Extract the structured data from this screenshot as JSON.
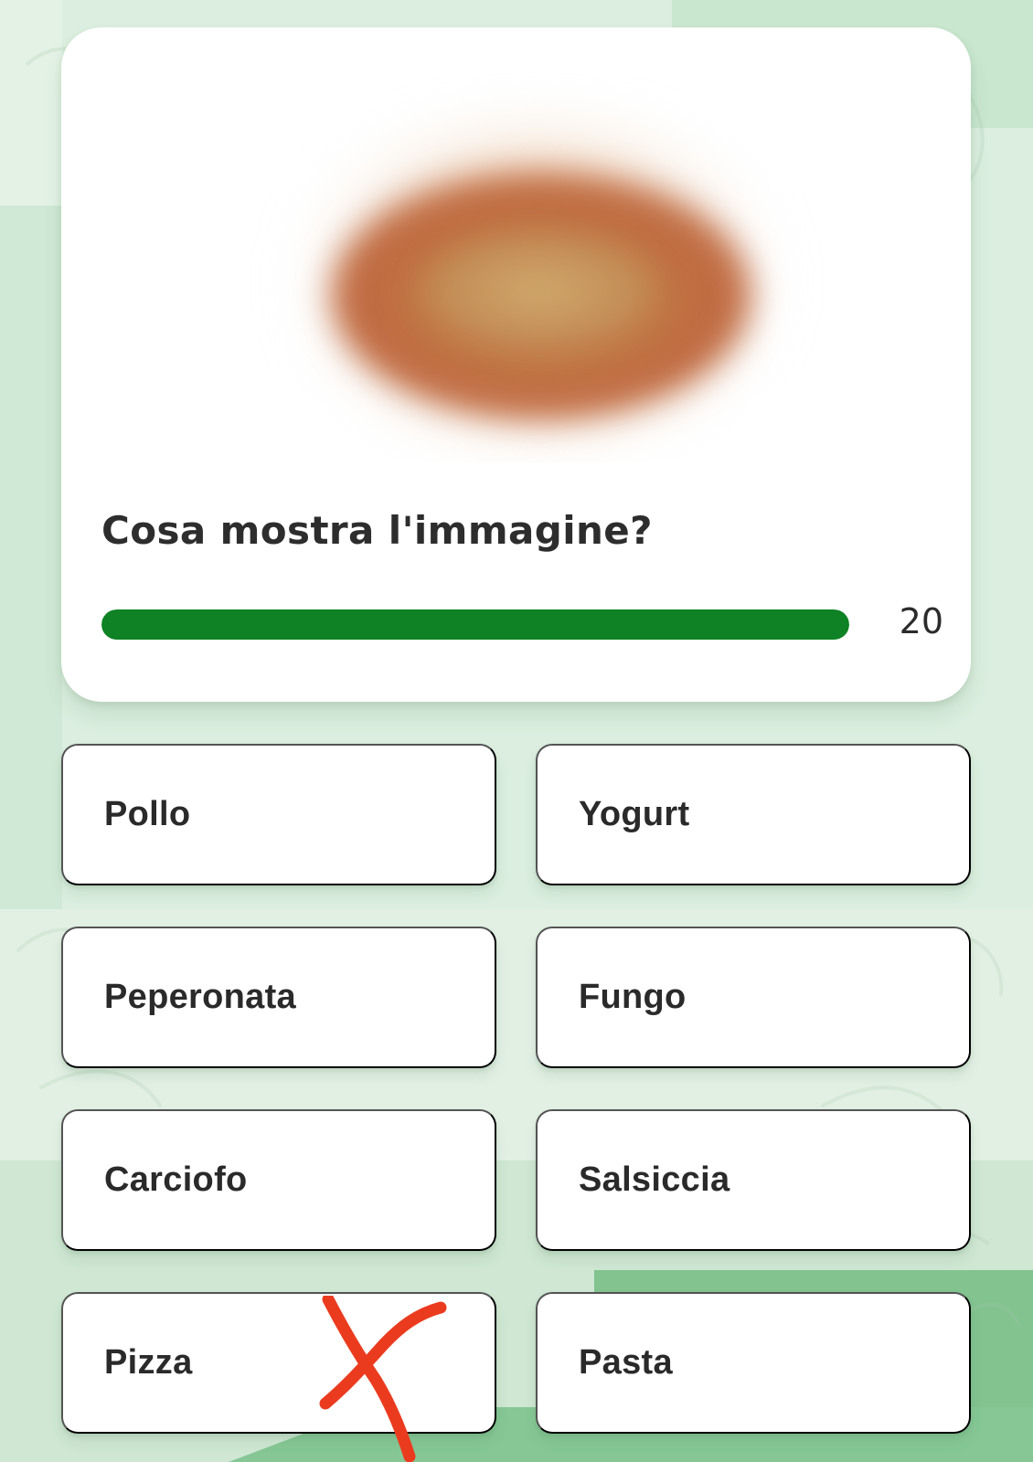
{
  "quiz": {
    "question": "Cosa mostra l'immagine?",
    "countdown": "20",
    "progress_percent": 100,
    "colors": {
      "progress": "#0e8224",
      "wrong_mark": "#eb3b1f"
    },
    "answers": [
      "Pollo",
      "Yogurt",
      "Peperonata",
      "Fungo",
      "Carciofo",
      "Salsiccia",
      "Pizza",
      "Pasta"
    ],
    "marked_wrong_answer": "Pizza"
  }
}
